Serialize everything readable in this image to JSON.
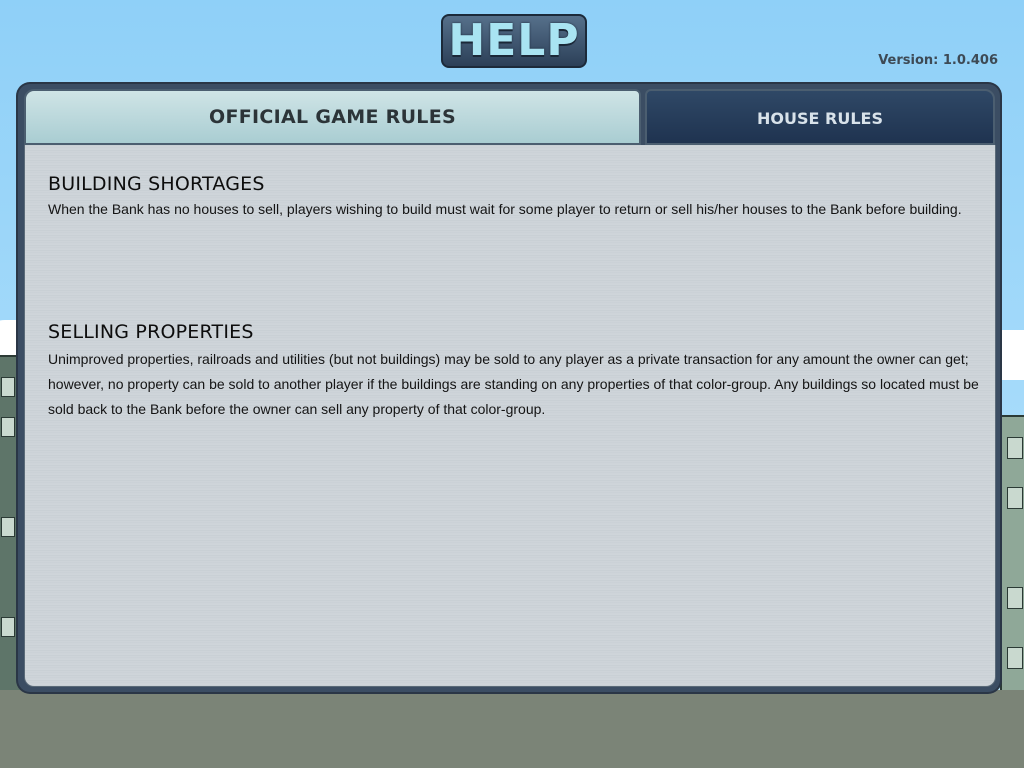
{
  "header": {
    "title": "HELP",
    "version": "Version: 1.0.406"
  },
  "tabs": [
    {
      "label": "OFFICIAL GAME RULES",
      "active": true
    },
    {
      "label": "HOUSE RULES",
      "active": false
    }
  ],
  "sections": [
    {
      "heading": "BUILDING SHORTAGES",
      "body": "When the Bank has no houses to sell, players wishing to build must wait for some player to return or sell his/her houses to the Bank before building."
    },
    {
      "heading": "SELLING PROPERTIES",
      "body": "Unimproved properties, railroads and utilities (but not buildings) may be sold to any player as a private transaction for any amount the owner can get; however, no property can be sold to another player if the buildings are standing on any properties of that color-group.  Any buildings so located must be sold back to the Bank before the owner can sell any property of that color-group."
    }
  ],
  "colors": {
    "sky": "#94d2f6",
    "tab_active": "#b9d8dc",
    "tab_inactive": "#23395a",
    "title_text": "#a9e4f2"
  }
}
